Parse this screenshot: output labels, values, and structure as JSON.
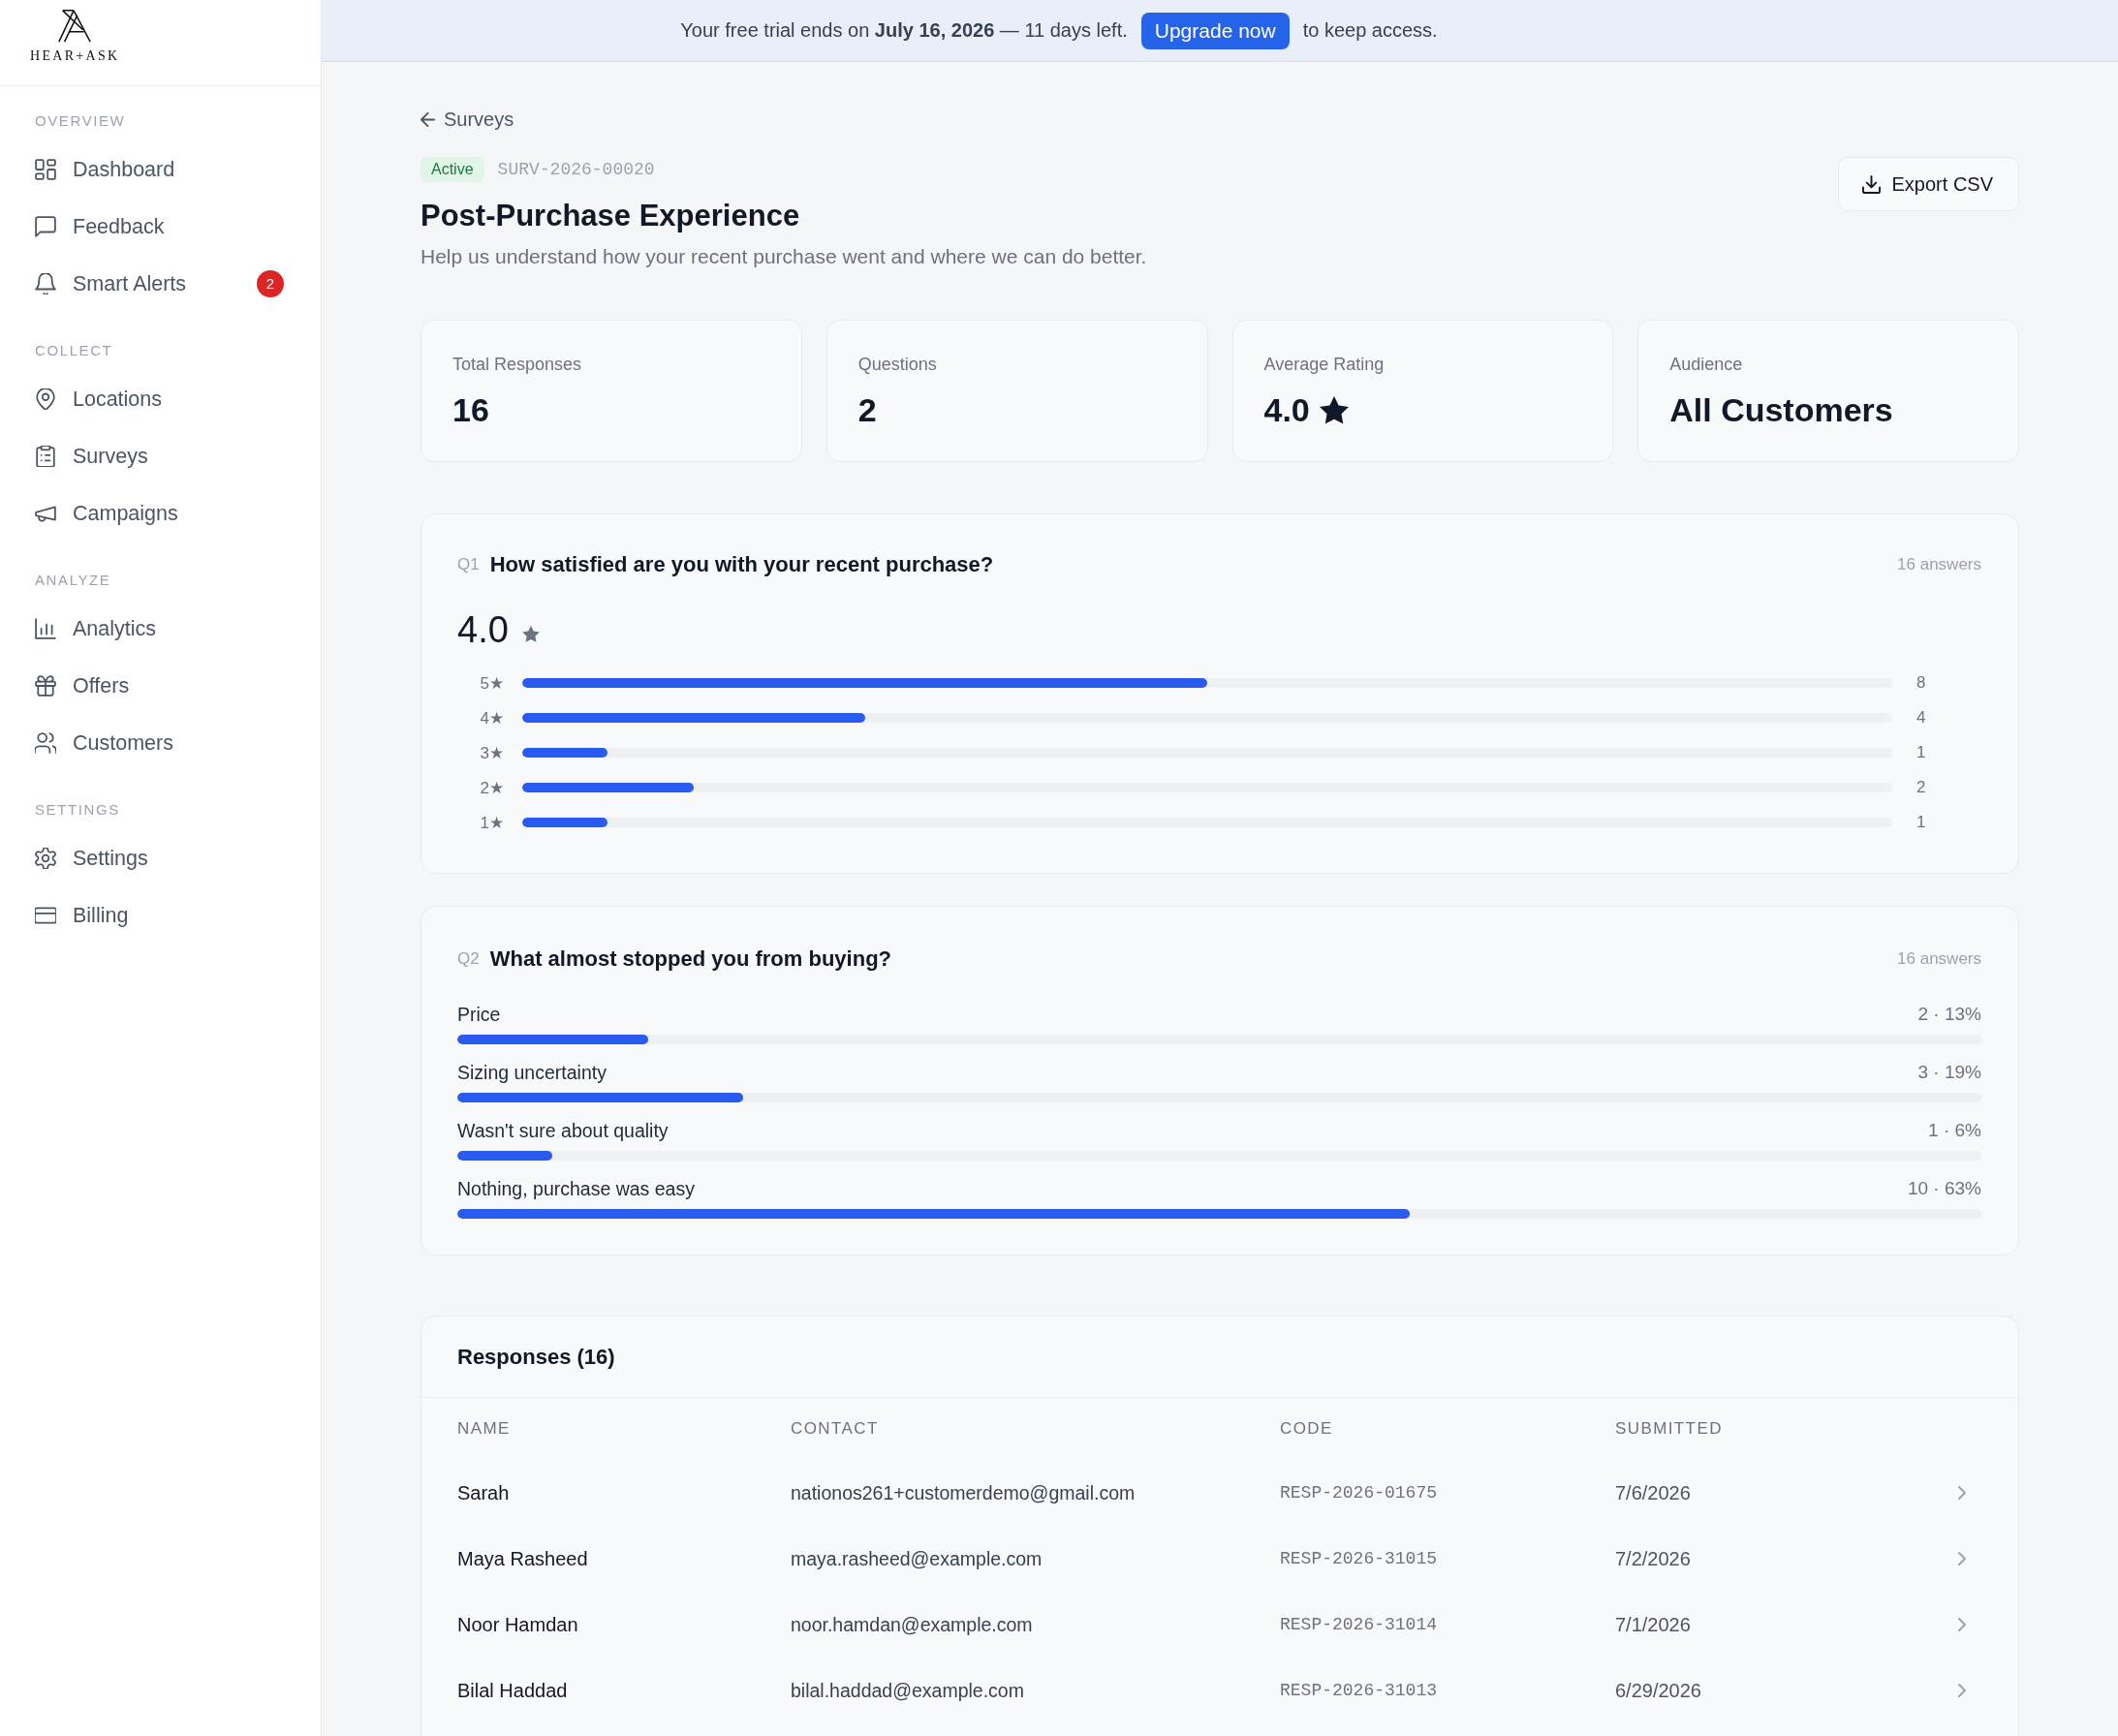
{
  "sidebar": {
    "logo": "HEAR+ASK",
    "sections": [
      {
        "title": "OVERVIEW",
        "items": [
          {
            "label": "Dashboard",
            "selected": false
          },
          {
            "label": "Feedback",
            "selected": false
          },
          {
            "label": "Smart Alerts",
            "selected": false,
            "badge": "2"
          }
        ]
      },
      {
        "title": "COLLECT",
        "items": [
          {
            "label": "Locations",
            "selected": false
          },
          {
            "label": "Surveys",
            "selected": false
          },
          {
            "label": "Campaigns",
            "selected": false
          }
        ]
      },
      {
        "title": "ANALYZE",
        "items": [
          {
            "label": "Analytics",
            "selected": false
          },
          {
            "label": "Offers",
            "selected": false
          },
          {
            "label": "Customers",
            "selected": false
          }
        ]
      },
      {
        "title": "SETTINGS",
        "items": [
          {
            "label": "Settings",
            "selected": false
          },
          {
            "label": "Billing",
            "selected": false
          }
        ]
      }
    ]
  },
  "banner": {
    "message": "Your free trial ends on **July 16, 2026** — 11 days left.",
    "button": "Upgrade now",
    "message_end": "to keep access."
  },
  "header": {
    "back_link": "Surveys",
    "status": "Active",
    "survey_id": "SURV-2026-00020",
    "title": "Post-Purchase Experience",
    "description": "Help us understand how your recent purchase went and where we can do better.",
    "export_button": "Export CSV"
  },
  "stats": [
    {
      "kind": "plain",
      "label": "Total Responses",
      "value": "16"
    },
    {
      "kind": "plain",
      "label": "Questions",
      "value": "2"
    },
    {
      "kind": "rating",
      "label": "Average Rating",
      "value": "4.0"
    },
    {
      "kind": "plain",
      "label": "Audience",
      "value": "All Customers"
    }
  ],
  "questions": [
    {
      "kind": "rating",
      "number": "Q1",
      "title": "How satisfied are you with your recent purchase?",
      "answers": "16 answers",
      "average": "4.0",
      "rows": [
        {
          "label": "5★",
          "level": 0.5,
          "count": "8"
        },
        {
          "label": "4★",
          "level": 0.25,
          "count": "4"
        },
        {
          "label": "3★",
          "level": 0.0625,
          "count": "1"
        },
        {
          "label": "2★",
          "level": 0.125,
          "count": "2"
        },
        {
          "label": "1★",
          "level": 0.0625,
          "count": "1"
        }
      ]
    },
    {
      "kind": "choice",
      "number": "Q2",
      "title": "What almost stopped you from buying?",
      "answers": "16 answers",
      "options": [
        {
          "label": "Price",
          "level": 0.125,
          "reading": "2 · 13%"
        },
        {
          "label": "Sizing uncertainty",
          "level": 0.1875,
          "reading": "3 · 19%"
        },
        {
          "label": "Wasn't sure about quality",
          "level": 0.0625,
          "reading": "1 · 6%"
        },
        {
          "label": "Nothing, purchase was easy",
          "level": 0.625,
          "reading": "10 · 63%"
        }
      ]
    }
  ],
  "responses": {
    "title": "Responses (16)",
    "columns": [
      "NAME",
      "CONTACT",
      "CODE",
      "SUBMITTED"
    ],
    "rows": [
      {
        "name": "Sarah",
        "contact": "nationos261+customerdemo@gmail.com",
        "code": "RESP-2026-01675",
        "submitted": "7/6/2026"
      },
      {
        "name": "Maya Rasheed",
        "contact": "maya.rasheed@example.com",
        "code": "RESP-2026-31015",
        "submitted": "7/2/2026"
      },
      {
        "name": "Noor Hamdan",
        "contact": "noor.hamdan@example.com",
        "code": "RESP-2026-31014",
        "submitted": "7/1/2026"
      },
      {
        "name": "Bilal Haddad",
        "contact": "bilal.haddad@example.com",
        "code": "RESP-2026-31013",
        "submitted": "6/29/2026"
      }
    ]
  }
}
